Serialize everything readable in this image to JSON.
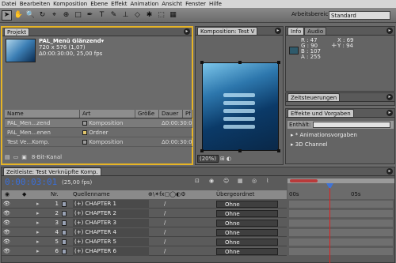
{
  "menubar": [
    "Datei",
    "Bearbeiten",
    "Komposition",
    "Ebene",
    "Effekt",
    "Animation",
    "Ansicht",
    "Fenster",
    "Hilfe"
  ],
  "workspace": {
    "label": "Arbeitsbereich:",
    "value": "Standard"
  },
  "project": {
    "tab": "Projekt",
    "name": "PAL_Menü Glänzend▾",
    "dims": "720 x 576 (1,07)",
    "duration": "Δ0:00:30:00, 25,00 fps",
    "columns": {
      "name": "Name",
      "art": "Art",
      "size": "Größe",
      "duration": "Dauer",
      "pf": "Pf"
    },
    "rows": [
      {
        "name": "PAL_Men...zend",
        "art": "Komposition",
        "size": "",
        "duration": "Δ0:00:30:00",
        "color": "#9a9a9a",
        "selected": true
      },
      {
        "name": "PAL_Men...enen",
        "art": "Ordner",
        "size": "",
        "duration": "",
        "color": "#e1c56b",
        "selected": false
      },
      {
        "name": "Test Ve...Komp.",
        "art": "Komposition",
        "size": "",
        "duration": "Δ0:00:30:00",
        "color": "#9a9a9a",
        "selected": false
      }
    ],
    "bitdepth": "8-Bit-Kanal"
  },
  "comp": {
    "tab": "Komposition: Test V",
    "zoom": "(20%)"
  },
  "info": {
    "tab": "Info",
    "tab2": "Audio",
    "R": "R : 47",
    "G": "G : 90",
    "B": "B : 107",
    "A": "A : 255",
    "X": "X : 69",
    "Y": "Y : 94",
    "swatch": "#2f5a6b"
  },
  "zeitsteuerungen": {
    "tab": "Zeitsteuerungen"
  },
  "effekte": {
    "tab": "Effekte und Vorgaben",
    "enthalt": "Enthält:",
    "items": [
      "* Animationsvorgaben",
      "3D Channel"
    ]
  },
  "timeline": {
    "tab": "Zeitleiste: Test Verknüpfte Komp.",
    "timecode": "0:00:03:01",
    "fps": "(25,00 fps)",
    "col_nr": "Nr.",
    "col_quelle": "Quellenname",
    "col_parent": "Übergeordnet",
    "ruler": [
      "00s",
      "05s"
    ],
    "layers": [
      {
        "nr": "1",
        "name": "(+) CHAPTER 1",
        "parent": "Ohne"
      },
      {
        "nr": "2",
        "name": "(+) CHAPTER 2",
        "parent": "Ohne"
      },
      {
        "nr": "3",
        "name": "(+) CHAPTER 3",
        "parent": "Ohne"
      },
      {
        "nr": "4",
        "name": "(+) CHAPTER 4",
        "parent": "Ohne"
      },
      {
        "nr": "5",
        "name": "(+) CHAPTER 5",
        "parent": "Ohne"
      },
      {
        "nr": "6",
        "name": "(+) CHAPTER 6",
        "parent": "Ohne"
      }
    ]
  },
  "colors": {
    "accent": "#e6b426",
    "timecode": "#3a6ed8",
    "cti": "#dd2222"
  }
}
